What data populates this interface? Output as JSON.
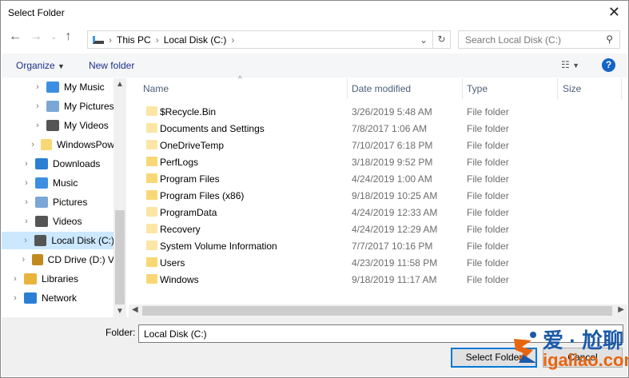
{
  "window": {
    "title": "Select Folder"
  },
  "address": {
    "crumbs": [
      "This PC",
      "Local Disk (C:)"
    ]
  },
  "search": {
    "placeholder": "Search Local Disk (C:)"
  },
  "toolbar": {
    "organize": "Organize",
    "new_folder": "New folder",
    "help": "?"
  },
  "tree": [
    {
      "label": "My Music",
      "indent": 2,
      "icon": "music-icon"
    },
    {
      "label": "My Pictures",
      "indent": 2,
      "icon": "pictures-icon"
    },
    {
      "label": "My Videos",
      "indent": 2,
      "icon": "videos-icon"
    },
    {
      "label": "WindowsPow",
      "indent": 2,
      "icon": "folder-icon"
    },
    {
      "label": "Downloads",
      "indent": 1,
      "icon": "downloads-icon"
    },
    {
      "label": "Music",
      "indent": 1,
      "icon": "music-icon"
    },
    {
      "label": "Pictures",
      "indent": 1,
      "icon": "pictures-icon"
    },
    {
      "label": "Videos",
      "indent": 1,
      "icon": "videos-icon"
    },
    {
      "label": "Local Disk (C:)",
      "indent": 1,
      "icon": "drive-icon",
      "selected": true
    },
    {
      "label": "CD Drive (D:) V",
      "indent": 1,
      "icon": "cd-drive-icon"
    },
    {
      "label": "Libraries",
      "indent": 0,
      "icon": "libraries-icon"
    },
    {
      "label": "Network",
      "indent": 0,
      "icon": "network-icon"
    }
  ],
  "columns": [
    "Name",
    "Date modified",
    "Type",
    "Size"
  ],
  "files": [
    {
      "name": "$Recycle.Bin",
      "date": "3/26/2019 5:48 AM",
      "type": "File folder",
      "hidden": true
    },
    {
      "name": "Documents and Settings",
      "date": "7/8/2017 1:06 AM",
      "type": "File folder",
      "hidden": true,
      "shortcut": true
    },
    {
      "name": "OneDriveTemp",
      "date": "7/10/2017 6:18 PM",
      "type": "File folder",
      "hidden": true
    },
    {
      "name": "PerfLogs",
      "date": "3/18/2019 9:52 PM",
      "type": "File folder"
    },
    {
      "name": "Program Files",
      "date": "4/24/2019 1:00 AM",
      "type": "File folder"
    },
    {
      "name": "Program Files (x86)",
      "date": "9/18/2019 10:25 AM",
      "type": "File folder"
    },
    {
      "name": "ProgramData",
      "date": "4/24/2019 12:33 AM",
      "type": "File folder",
      "hidden": true
    },
    {
      "name": "Recovery",
      "date": "4/24/2019 12:29 AM",
      "type": "File folder",
      "hidden": true
    },
    {
      "name": "System Volume Information",
      "date": "7/7/2017 10:16 PM",
      "type": "File folder",
      "hidden": true
    },
    {
      "name": "Users",
      "date": "4/23/2019 11:58 PM",
      "type": "File folder"
    },
    {
      "name": "Windows",
      "date": "9/18/2019 11:17 AM",
      "type": "File folder"
    }
  ],
  "footer": {
    "folder_label": "Folder:",
    "folder_value": "Local Disk (C:)",
    "select_button": "Select Folder",
    "cancel_button": "Cancel"
  },
  "watermark": {
    "text_cn": "爱·尬聊",
    "text_en": "igaliao.com"
  },
  "colors": {
    "accent": "#0078d7",
    "selection": "#cce8ff",
    "folder": "#f8d775"
  }
}
